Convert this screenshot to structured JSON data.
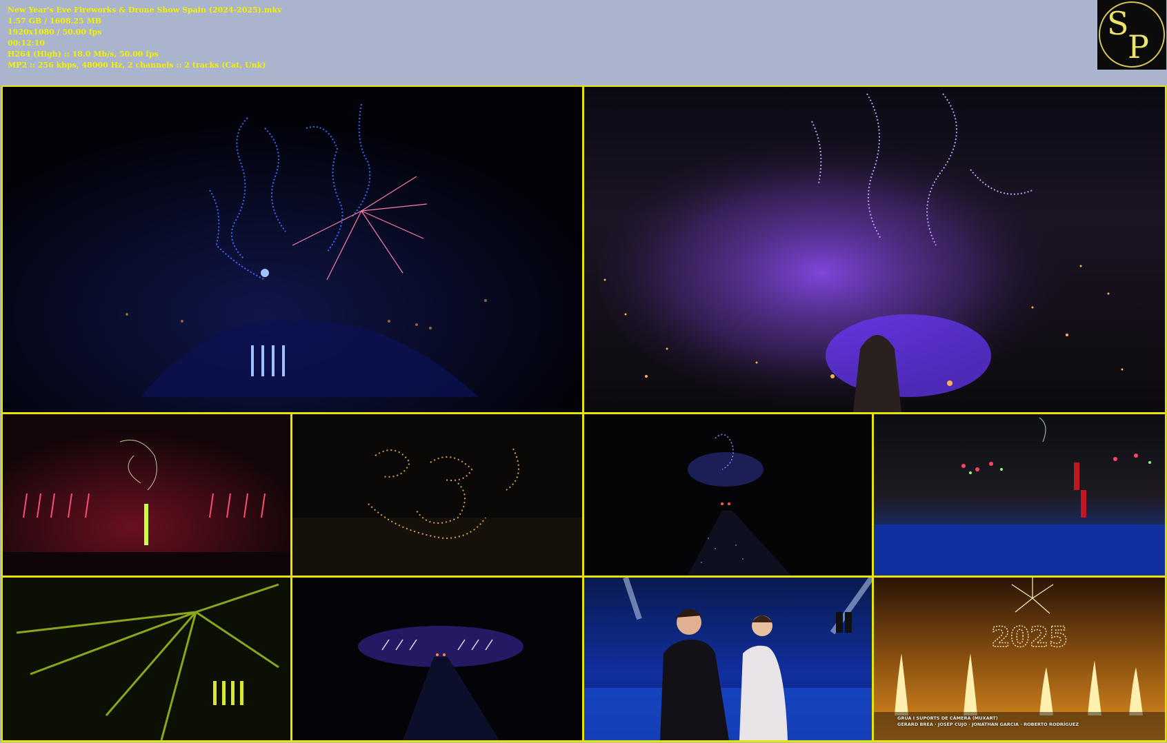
{
  "file_info": {
    "filename": "New Year's Eve Fireworks & Drone Show Spain (2024-2025).mkv",
    "size": "1.57 GB / 1608.25 MB",
    "resolution": "1920x1080 / 50.00 fps",
    "duration": "00:12:10",
    "video": "H264 (High) :: 18.0 Mb/s, 50.00 fps",
    "audio": "MP2 :: 256 kbps, 48000 Hz, 2 channels :: 2 tracks (Cat, Unk)"
  },
  "logo": {
    "text": "SP",
    "colors": {
      "ring": "#d8c25a",
      "letters": "#f0e36a",
      "background": "#0b0b0b"
    }
  },
  "frame_colors": {
    "border": "#e8e400",
    "background": "#aab4cc",
    "text": "#f4f000"
  },
  "thumbnails": [
    {
      "name": "drone-faces-dark-sky",
      "scene": "blue drone figures over dark sky"
    },
    {
      "name": "drones-over-city-purple-smoke",
      "scene": "aerial city with purple smoke"
    },
    {
      "name": "red-fireworks-drones",
      "scene": "red fireworks with drone outlines"
    },
    {
      "name": "drone-cartoon-outline",
      "scene": "yellow dotted drone drawing"
    },
    {
      "name": "drone-figure-avenue",
      "scene": "blue drone figure above avenue"
    },
    {
      "name": "crowd-with-fireworks",
      "scene": "crowd in blue light with fireworks"
    },
    {
      "name": "green-lasers",
      "scene": "green laser beams"
    },
    {
      "name": "avenue-fireworks-night",
      "scene": "fireworks over avenue"
    },
    {
      "name": "hosts-on-stage",
      "scene": "two hosts on stage"
    },
    {
      "name": "fireworks-2025",
      "scene": "golden fireworks with 2025 drones"
    }
  ],
  "credits": {
    "line1": "GRUA I SUPORTS DE CÀMERA (MUXART)",
    "line2": "GERARD BREA · JOSEP CUJO · JONATHAN GARCIA · ROBERTO RODRÍGUEZ"
  },
  "drone_year": "2025"
}
